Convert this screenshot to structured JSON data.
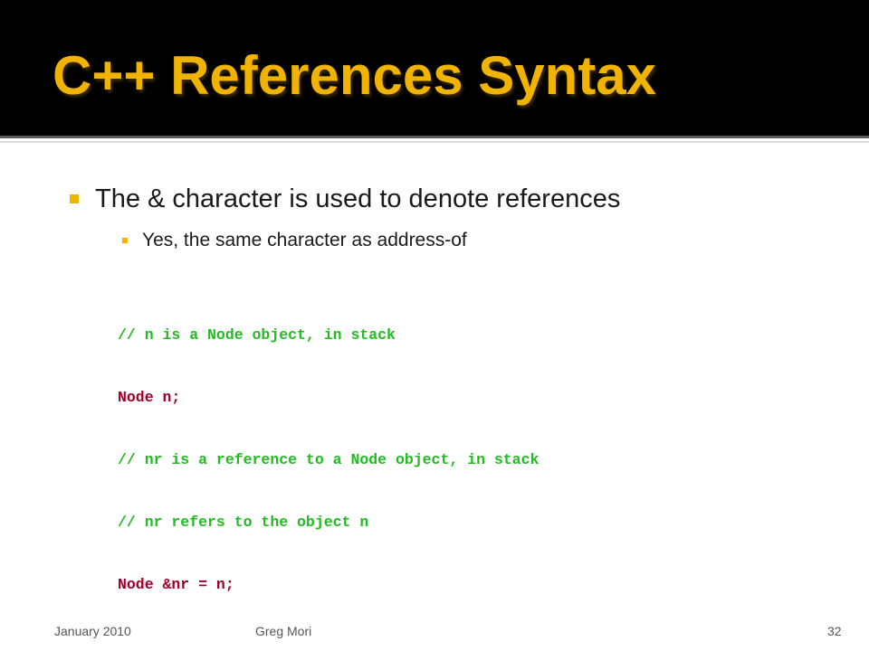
{
  "slide": {
    "title": "C++ References Syntax",
    "bullets": [
      {
        "text": "The & character is used to denote references",
        "sub": "Yes, the same character as address-of"
      }
    ],
    "code_lines": [
      {
        "text": "// n is a Node object, in stack",
        "kind": "comment"
      },
      {
        "text": "Node n;",
        "kind": "code"
      },
      {
        "text": "// nr is a reference to a Node object, in stack",
        "kind": "comment"
      },
      {
        "text": "// nr refers to the object n",
        "kind": "comment"
      },
      {
        "text": "Node &nr = n;",
        "kind": "code"
      }
    ],
    "footer": {
      "date": "January 2010",
      "author": "Greg Mori",
      "page": "32"
    }
  },
  "colors": {
    "title": "#f0b400",
    "title_bar": "#000000",
    "bullet_marker": "#f0b400",
    "code_comment": "#22bb22",
    "code_text": "#a00028"
  }
}
